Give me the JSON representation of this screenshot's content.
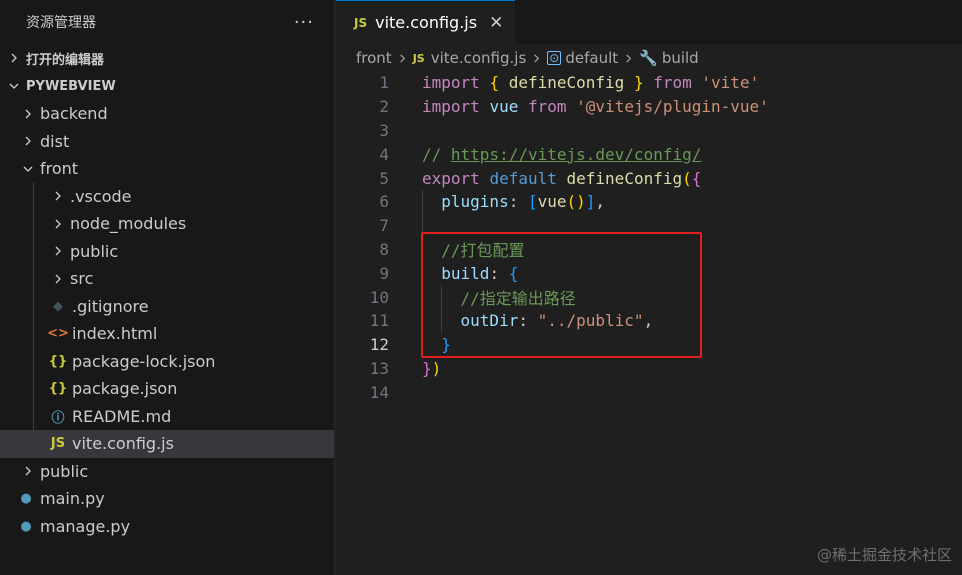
{
  "explorer": {
    "title": "资源管理器",
    "more": "···",
    "open_editors": "打开的编辑器",
    "project": "PYWEBVIEW",
    "items": [
      {
        "label": "backend",
        "indent": 1,
        "kind": "folder",
        "open": false
      },
      {
        "label": "dist",
        "indent": 1,
        "kind": "folder",
        "open": false
      },
      {
        "label": "front",
        "indent": 1,
        "kind": "folder",
        "open": true
      },
      {
        "label": ".vscode",
        "indent": 2,
        "kind": "folder",
        "open": false
      },
      {
        "label": "node_modules",
        "indent": 2,
        "kind": "folder",
        "open": false
      },
      {
        "label": "public",
        "indent": 2,
        "kind": "folder",
        "open": false
      },
      {
        "label": "src",
        "indent": 2,
        "kind": "folder",
        "open": false
      },
      {
        "label": ".gitignore",
        "indent": 2,
        "kind": "gitignore"
      },
      {
        "label": "index.html",
        "indent": 2,
        "kind": "html"
      },
      {
        "label": "package-lock.json",
        "indent": 2,
        "kind": "json"
      },
      {
        "label": "package.json",
        "indent": 2,
        "kind": "json"
      },
      {
        "label": "README.md",
        "indent": 2,
        "kind": "info"
      },
      {
        "label": "vite.config.js",
        "indent": 2,
        "kind": "js",
        "selected": true
      },
      {
        "label": "public",
        "indent": 1,
        "kind": "folder",
        "open": false
      },
      {
        "label": "main.py",
        "indent": 1,
        "kind": "python"
      },
      {
        "label": "manage.py",
        "indent": 1,
        "kind": "python"
      }
    ]
  },
  "tab": {
    "icon": "JS",
    "label": "vite.config.js",
    "close": "✕"
  },
  "breadcrumb": {
    "folder": "front",
    "file_icon": "JS",
    "file": "vite.config.js",
    "symbol1": "default",
    "symbol2": "build"
  },
  "code": {
    "line_numbers": [
      "1",
      "2",
      "3",
      "4",
      "5",
      "6",
      "7",
      "8",
      "9",
      "10",
      "11",
      "12",
      "13",
      "14"
    ],
    "active_line": "12"
  },
  "watermark": "@稀土掘金技术社区",
  "colors": {
    "highlight_box": "#e0201c",
    "accent": "#0078d4"
  }
}
